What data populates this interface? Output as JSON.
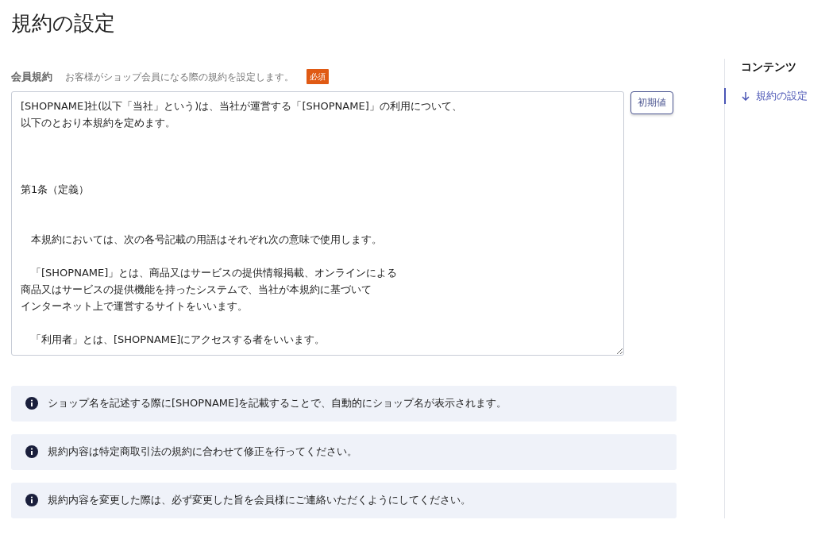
{
  "page_title": "規約の設定",
  "terms_field": {
    "label": "会員規約",
    "help": "お客様がショップ会員になる際の規約を設定します。",
    "required_badge": "必須",
    "lines": [
      {
        "kind": "text",
        "text": "[SHOPNAME]社(以下「当社」という)は、当社が運営する「[SHOPNAME]」の利用について、"
      },
      {
        "kind": "text",
        "text": "以下のとおり本規約を定めます。"
      },
      {
        "kind": "blank"
      },
      {
        "kind": "blank"
      },
      {
        "kind": "blank"
      },
      {
        "kind": "text",
        "text": "第1条（定義）"
      },
      {
        "kind": "blank"
      },
      {
        "kind": "blank"
      },
      {
        "kind": "text",
        "text": "　本規約においては、次の各号記載の用語はそれぞれ次の意味で使用します。"
      },
      {
        "kind": "blank"
      },
      {
        "kind": "text",
        "text": "　「[SHOPNAME]」とは、商品又はサービスの提供情報掲載、オンラインによる"
      },
      {
        "kind": "text",
        "text": "商品又はサービスの提供機能を持ったシステムで、当社が本規約に基づいて"
      },
      {
        "kind": "text",
        "text": "インターネット上で運営するサイトをいいます。"
      },
      {
        "kind": "blank"
      },
      {
        "kind": "text",
        "text": "　「利用者」とは、[SHOPNAME]にアクセスする者をいいます。"
      }
    ]
  },
  "reset_button": "初期値",
  "notes": [
    "ショップ名を記述する際に[SHOPNAME]を記載することで、自動的にショップ名が表示されます。",
    "規約内容は特定商取引法の規約に合わせて修正を行ってください。",
    "規約内容を変更した際は、必ず変更した旨を会員様にご連絡いただくようにしてください。"
  ],
  "toc": {
    "heading": "コンテンツ",
    "items": [
      {
        "label": "規約の設定",
        "selected": true
      }
    ]
  }
}
